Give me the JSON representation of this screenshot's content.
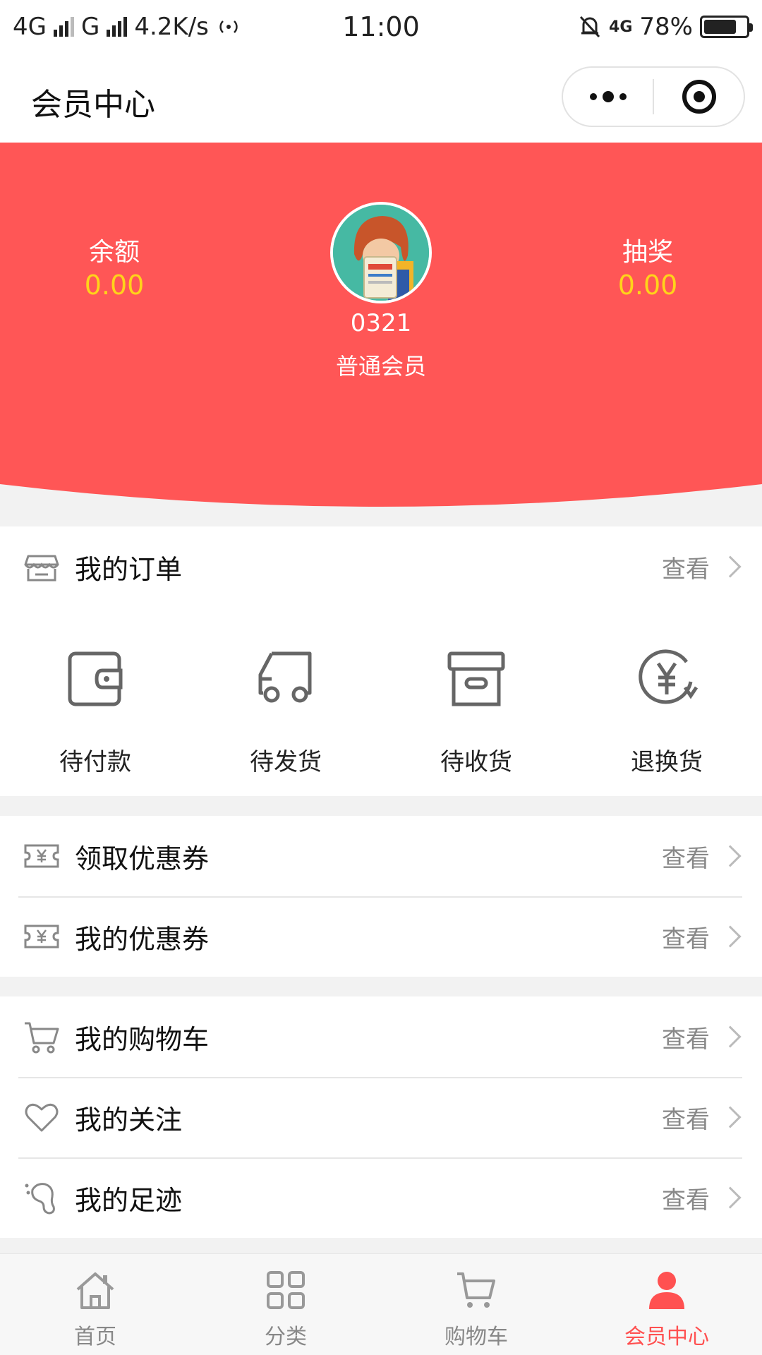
{
  "status_bar": {
    "network1": "4G",
    "network2": "G",
    "speed": "4.2K/s",
    "time": "11:00",
    "net_right": "4G",
    "battery": "78%"
  },
  "nav": {
    "title": "会员中心"
  },
  "header": {
    "bg_color": "#ff5656",
    "balance_label": "余额",
    "balance_value": "0.00",
    "lottery_label": "抽奖",
    "lottery_value": "0.00",
    "user_id": "0321",
    "member_level": "普通会员"
  },
  "orders": {
    "title": "我的订单",
    "more": "查看",
    "items": [
      {
        "label": "待付款",
        "icon": "wallet-icon"
      },
      {
        "label": "待发货",
        "icon": "truck-icon"
      },
      {
        "label": "待收货",
        "icon": "box-icon"
      },
      {
        "label": "退换货",
        "icon": "yen-refund-icon"
      }
    ]
  },
  "coupons": [
    {
      "title": "领取优惠券",
      "more": "查看",
      "icon": "coupon-icon"
    },
    {
      "title": "我的优惠券",
      "more": "查看",
      "icon": "coupon-icon"
    }
  ],
  "misc": [
    {
      "title": "我的购物车",
      "more": "查看",
      "icon": "cart-icon"
    },
    {
      "title": "我的关注",
      "more": "查看",
      "icon": "heart-icon"
    },
    {
      "title": "我的足迹",
      "more": "查看",
      "icon": "footprint-icon"
    }
  ],
  "tabbar": {
    "active_color": "#ff5151",
    "tabs": [
      {
        "label": "首页",
        "icon": "home-icon"
      },
      {
        "label": "分类",
        "icon": "grid-icon"
      },
      {
        "label": "购物车",
        "icon": "cart-icon"
      },
      {
        "label": "会员中心",
        "icon": "user-icon",
        "active": true
      }
    ]
  }
}
